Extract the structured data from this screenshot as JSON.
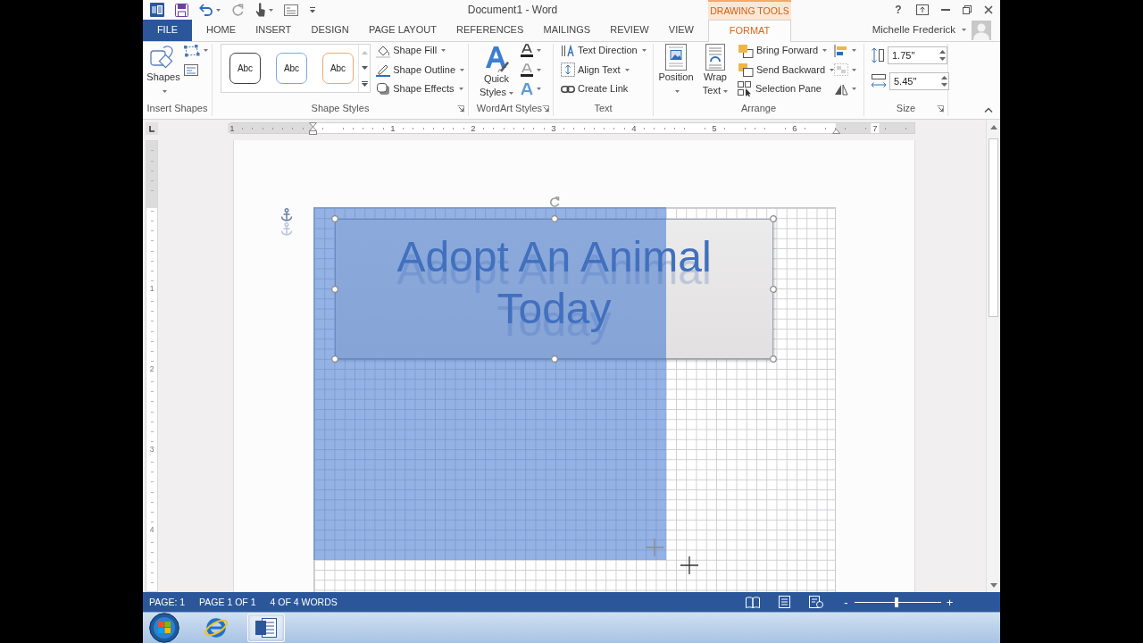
{
  "title_bar": {
    "title": "Document1 - Word",
    "context_header": "DRAWING TOOLS",
    "help": "?"
  },
  "tabs": [
    {
      "label": "FILE",
      "kind": "file",
      "selected": false
    },
    {
      "label": "HOME",
      "kind": "standard",
      "selected": false
    },
    {
      "label": "INSERT",
      "kind": "standard",
      "selected": false
    },
    {
      "label": "DESIGN",
      "kind": "standard",
      "selected": false
    },
    {
      "label": "PAGE LAYOUT",
      "kind": "standard",
      "selected": false
    },
    {
      "label": "REFERENCES",
      "kind": "standard",
      "selected": false
    },
    {
      "label": "MAILINGS",
      "kind": "standard",
      "selected": false
    },
    {
      "label": "REVIEW",
      "kind": "standard",
      "selected": false
    },
    {
      "label": "VIEW",
      "kind": "standard",
      "selected": false
    },
    {
      "label": "FORMAT",
      "kind": "contextual",
      "selected": true
    }
  ],
  "account": {
    "name": "Michelle Frederick"
  },
  "ribbon": {
    "insert_shapes": {
      "label": "Insert Shapes",
      "button": {
        "label": "Shapes",
        "dropdown": true
      }
    },
    "shape_styles": {
      "label": "Shape Styles",
      "presets": [
        {
          "text": "Abc",
          "color": "#404040"
        },
        {
          "text": "Abc",
          "color": "#7ea6dc"
        },
        {
          "text": "Abc",
          "color": "#eea86a"
        }
      ],
      "commands": [
        {
          "label": "Shape Fill",
          "dropdown": true
        },
        {
          "label": "Shape Outline",
          "dropdown": true
        },
        {
          "label": "Shape Effects",
          "dropdown": true
        }
      ]
    },
    "wordart_styles": {
      "label": "WordArt Styles",
      "button": {
        "label": "Quick Styles",
        "dropdown": true
      }
    },
    "text": {
      "label": "Text",
      "commands": [
        {
          "label": "Text Direction",
          "dropdown": true
        },
        {
          "label": "Align Text",
          "dropdown": true
        },
        {
          "label": "Create Link",
          "dropdown": false
        }
      ]
    },
    "arrange": {
      "label": "Arrange",
      "buttons": [
        {
          "label": "Position",
          "dropdown": true
        },
        {
          "label": "Wrap Text",
          "dropdown": true
        }
      ],
      "commands": [
        {
          "label": "Bring Forward",
          "dropdown": true
        },
        {
          "label": "Send Backward",
          "dropdown": true
        },
        {
          "label": "Selection Pane",
          "dropdown": false
        }
      ]
    },
    "size": {
      "label": "Size",
      "fields": [
        {
          "kind": "height",
          "value": "1.75\""
        },
        {
          "kind": "width",
          "value": "5.45\""
        }
      ]
    }
  },
  "ruler": {
    "labels": [
      "1",
      "1",
      "2",
      "3",
      "4",
      "5",
      "6",
      "7"
    ]
  },
  "vertical_ruler": {
    "labels": [
      "1",
      "2",
      "3",
      "4"
    ]
  },
  "document": {
    "text_box": {
      "text": "Adopt An Animal Today",
      "selected": true
    }
  },
  "status_bar": {
    "items": [
      "PAGE: 1",
      "PAGE 1 OF 1",
      "4 OF 4 WORDS"
    ],
    "zoom": {
      "minus": "-",
      "plus": "+",
      "level": 0.48
    }
  },
  "taskbar": {
    "apps": [
      {
        "kind": "browser",
        "active": false
      },
      {
        "kind": "word",
        "active": true
      }
    ]
  }
}
